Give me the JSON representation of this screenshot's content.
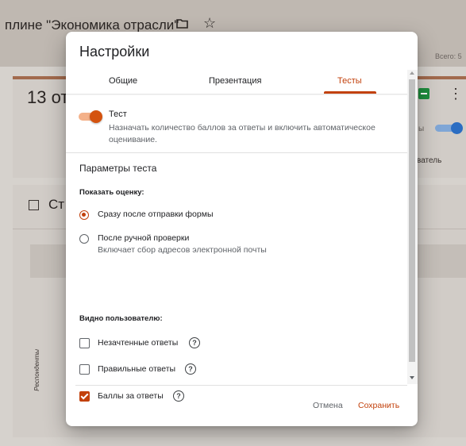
{
  "background": {
    "form_title": "ине \"Экономика отрасли\"",
    "title_prefix": "пл",
    "total_label": "Всего: 5",
    "responses_count": "13 от",
    "toggle_label_fragment": "ы",
    "user_label_fragment": "ватель",
    "summary_title": "Ст",
    "axis_label": "Респонденты"
  },
  "dialog": {
    "title": "Настройки",
    "tabs": [
      {
        "label": "Общие",
        "active": false
      },
      {
        "label": "Презентация",
        "active": false
      },
      {
        "label": "Тесты",
        "active": true
      }
    ],
    "quiz": {
      "enabled": true,
      "title": "Тест",
      "description": "Назначать количество баллов за ответы и включить автоматическое оценивание."
    },
    "params_title": "Параметры теста",
    "show_grade": {
      "title": "Показать оценку:",
      "options": [
        {
          "label": "Сразу после отправки формы",
          "sub": "",
          "selected": true
        },
        {
          "label": "После ручной проверки",
          "sub": "Включает сбор адресов электронной почты",
          "selected": false
        }
      ]
    },
    "visible_to_user": {
      "title": "Видно пользователю:",
      "options": [
        {
          "label": "Незачтенные ответы",
          "checked": false
        },
        {
          "label": "Правильные ответы",
          "checked": false
        },
        {
          "label": "Баллы за ответы",
          "checked": true
        }
      ]
    },
    "help_glyph": "?",
    "buttons": {
      "cancel": "Отмена",
      "save": "Сохранить"
    }
  },
  "colors": {
    "accent": "#c2410c",
    "toggle_track": "#f4b189",
    "sheets_green": "#1e8e3e"
  }
}
